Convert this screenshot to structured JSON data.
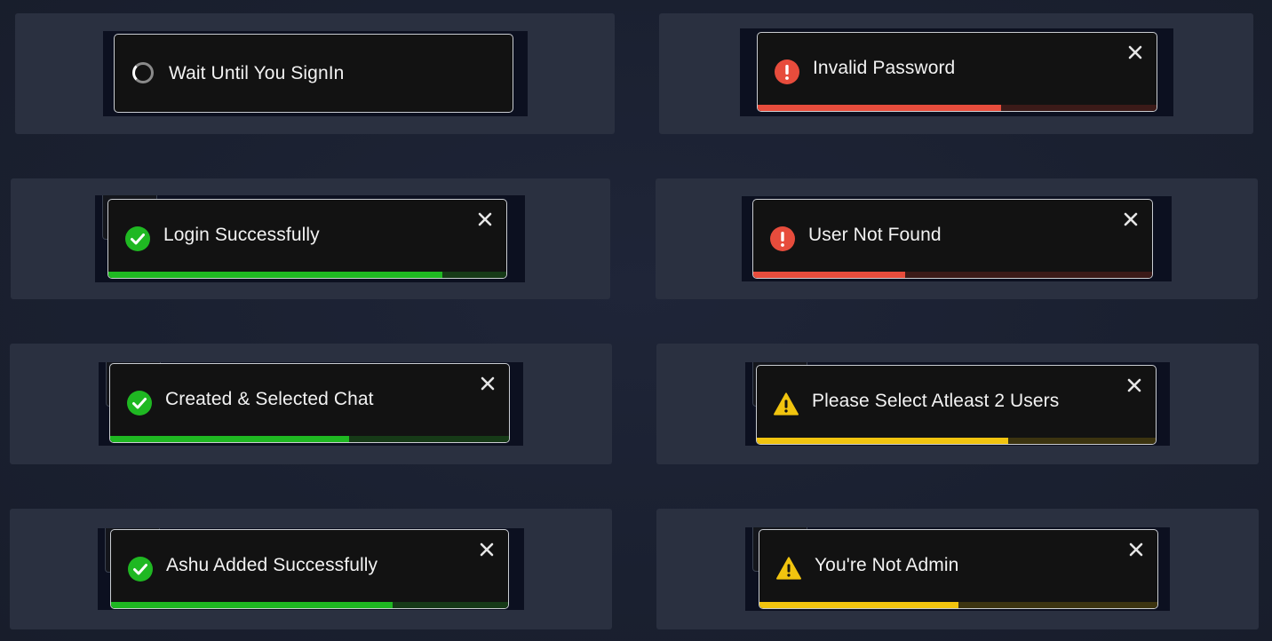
{
  "colors": {
    "success": "#1fb822",
    "success_track": "#163a17",
    "error": "#e74c3c",
    "error_track": "#3b1a18",
    "warning": "#f1c40f",
    "warning_track": "#3c3410"
  },
  "toasts": [
    {
      "message": "Wait Until You SignIn",
      "type": "loading",
      "icon": "spinner-icon",
      "closable": false
    },
    {
      "message": "Invalid Password",
      "type": "error",
      "icon": "error-icon",
      "closable": true,
      "progress": 0.61
    },
    {
      "message": "Login Successfully",
      "type": "success",
      "icon": "check-circle-icon",
      "closable": true,
      "progress": 0.84
    },
    {
      "message": "User Not Found",
      "type": "error",
      "icon": "error-icon",
      "closable": true,
      "progress": 0.38
    },
    {
      "message": "Created & Selected Chat",
      "type": "success",
      "icon": "check-circle-icon",
      "closable": true,
      "progress": 0.6
    },
    {
      "message": "Please Select Atleast 2 Users",
      "type": "warning",
      "icon": "warning-icon",
      "closable": true,
      "progress": 0.63
    },
    {
      "message": "Ashu Added Successfully",
      "type": "success",
      "icon": "check-circle-icon",
      "closable": true,
      "progress": 0.71
    },
    {
      "message": "You're Not Admin",
      "type": "warning",
      "icon": "warning-icon",
      "closable": true,
      "progress": 0.5
    }
  ]
}
